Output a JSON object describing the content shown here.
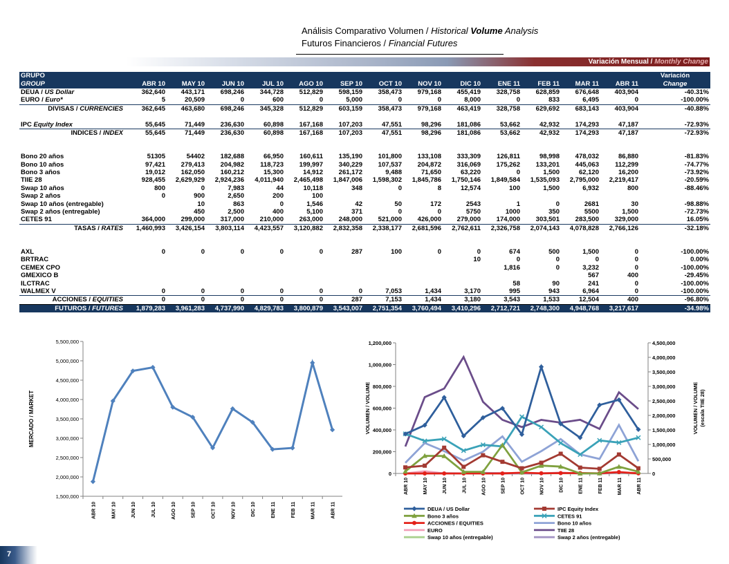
{
  "header": {
    "line1_a": "Análisis Comparativo Volumen / ",
    "line1_b": "Historical ",
    "line1_c": "Volume",
    "line1_d": " Analysis",
    "line2_a": "Futuros Financieros / ",
    "line2_b": "Financial Futures"
  },
  "band": {
    "label_a": "Variación Mensual / ",
    "label_b": "Monthly Change"
  },
  "table": {
    "head1": {
      "grupo": "GRUPO",
      "variacion": "Variación"
    },
    "head2": {
      "group": "GROUP",
      "change": "Change",
      "months": [
        "ABR 10",
        "MAY 10",
        "JUN 10",
        "JUL 10",
        "AGO 10",
        "SEP 10",
        "OCT 10",
        "NOV 10",
        "DIC 10",
        "ENE 11",
        "FEB 11",
        "MAR 11",
        "ABR 11"
      ]
    },
    "deua": {
      "label_a": "DEUA / ",
      "label_b": "US Dollar",
      "v": [
        "362,640",
        "443,171",
        "698,246",
        "344,728",
        "512,829",
        "598,159",
        "358,473",
        "979,168",
        "455,419",
        "328,758",
        "628,859",
        "676,648",
        "403,904"
      ],
      "chg": "-40.31%"
    },
    "euro": {
      "label_a": "EURO / ",
      "label_b": "Euro*",
      "v": [
        "5",
        "20,509",
        "0",
        "600",
        "0",
        "5,000",
        "0",
        "0",
        "8,000",
        "0",
        "833",
        "6,495",
        "0"
      ],
      "chg": "-100.00%"
    },
    "divisas": {
      "label_a": "DIVISAS / ",
      "label_b": "CURRENCIES",
      "v": [
        "362,645",
        "463,680",
        "698,246",
        "345,328",
        "512,829",
        "603,159",
        "358,473",
        "979,168",
        "463,419",
        "328,758",
        "629,692",
        "683,143",
        "403,904"
      ],
      "chg": "-40.88%"
    },
    "ipc": {
      "label_a": "IPC ",
      "label_b": "Equity Index",
      "v": [
        "55,645",
        "71,449",
        "236,630",
        "60,898",
        "167,168",
        "107,203",
        "47,551",
        "98,296",
        "181,086",
        "53,662",
        "42,932",
        "174,293",
        "47,187"
      ],
      "chg": "-72.93%"
    },
    "indices": {
      "label_a": "INDICES / ",
      "label_b": "INDEX",
      "v": [
        "55,645",
        "71,449",
        "236,630",
        "60,898",
        "167,168",
        "107,203",
        "47,551",
        "98,296",
        "181,086",
        "53,662",
        "42,932",
        "174,293",
        "47,187"
      ],
      "chg": "-72.93%"
    },
    "rates": [
      {
        "label": "Bono 20 años",
        "v": [
          "51305",
          "54402",
          "182,688",
          "66,950",
          "160,611",
          "135,190",
          "101,800",
          "133,108",
          "333,309",
          "126,811",
          "98,998",
          "478,032",
          "86,880"
        ],
        "chg": "-81.83%"
      },
      {
        "label": "Bono 10 años",
        "v": [
          "97,421",
          "279,413",
          "204,982",
          "118,723",
          "199,997",
          "340,229",
          "107,537",
          "204,872",
          "316,069",
          "175,262",
          "133,201",
          "445,063",
          "112,299"
        ],
        "chg": "-74.77%"
      },
      {
        "label": "Bono 3 años",
        "v": [
          "19,012",
          "162,050",
          "160,212",
          "15,300",
          "14,912",
          "261,172",
          "9,488",
          "71,650",
          "63,220",
          "0",
          "1,500",
          "62,120",
          "16,200"
        ],
        "chg": "-73.92%"
      },
      {
        "label": "TIIE 28",
        "v": [
          "928,455",
          "2,629,929",
          "2,924,236",
          "4,011,940",
          "2,465,498",
          "1,847,006",
          "1,598,302",
          "1,845,786",
          "1,750,146",
          "1,849,584",
          "1,535,093",
          "2,795,000",
          "2,219,417"
        ],
        "chg": "-20.59%"
      },
      {
        "label": "Swap 10 años",
        "v": [
          "800",
          "0",
          "7,983",
          "44",
          "10,118",
          "348",
          "0",
          "8",
          "12,574",
          "100",
          "1,500",
          "6,932",
          "800"
        ],
        "chg": "-88.46%"
      },
      {
        "label": "Swap 2 años",
        "v": [
          "0",
          "900",
          "2,650",
          "200",
          "100",
          "",
          "",
          "",
          "",
          "",
          "",
          "",
          ""
        ],
        "chg": ""
      },
      {
        "label": "Swap 10 años (entregable)",
        "v": [
          "",
          "10",
          "863",
          "0",
          "1,546",
          "42",
          "50",
          "172",
          "2543",
          "1",
          "0",
          "2681",
          "30"
        ],
        "chg": "-98.88%"
      },
      {
        "label": "Swap 2 años (entregable)",
        "v": [
          "",
          "450",
          "2,500",
          "400",
          "5,100",
          "371",
          "0",
          "0",
          "5750",
          "1000",
          "350",
          "5500",
          "1,500"
        ],
        "chg": "-72.73%"
      },
      {
        "label": "CETES 91",
        "v": [
          "364,000",
          "299,000",
          "317,000",
          "210,000",
          "263,000",
          "248,000",
          "521,000",
          "426,000",
          "279,000",
          "174,000",
          "303,501",
          "283,500",
          "329,000"
        ],
        "chg": "16.05%"
      }
    ],
    "tasas": {
      "label_a": "TASAS / ",
      "label_b": "RATES",
      "v": [
        "1,460,993",
        "3,426,154",
        "3,803,114",
        "4,423,557",
        "3,120,882",
        "2,832,358",
        "2,338,177",
        "2,681,596",
        "2,762,611",
        "2,326,758",
        "2,074,143",
        "4,078,828",
        "2,766,126"
      ],
      "chg": "-32.18%"
    },
    "equities": [
      {
        "label": "AXL",
        "v": [
          "0",
          "0",
          "0",
          "0",
          "0",
          "287",
          "100",
          "0",
          "0",
          "674",
          "500",
          "1,500",
          "0"
        ],
        "chg": "-100.00%"
      },
      {
        "label": "BRTRAC",
        "v": [
          "",
          "",
          "",
          "",
          "",
          "",
          "",
          "",
          "10",
          "0",
          "0",
          "0",
          "0"
        ],
        "chg": "0.00%"
      },
      {
        "label": "CEMEX CPO",
        "v": [
          "",
          "",
          "",
          "",
          "",
          "",
          "",
          "",
          "",
          "1,816",
          "0",
          "3,232",
          "0"
        ],
        "chg": "-100.00%"
      },
      {
        "label": "GMEXICO B",
        "v": [
          "",
          "",
          "",
          "",
          "",
          "",
          "",
          "",
          "",
          "",
          "",
          "567",
          "400"
        ],
        "chg": "-29.45%"
      },
      {
        "label": "ILCTRAC",
        "v": [
          "",
          "",
          "",
          "",
          "",
          "",
          "",
          "",
          "",
          "58",
          "90",
          "241",
          "0"
        ],
        "chg": "-100.00%"
      },
      {
        "label": "WALMEX V",
        "v": [
          "0",
          "0",
          "0",
          "0",
          "0",
          "0",
          "7,053",
          "1,434",
          "3,170",
          "995",
          "943",
          "6,964",
          "0"
        ],
        "chg": "-100.00%"
      }
    ],
    "acciones": {
      "label_a": "ACCIONES / ",
      "label_b": "EQUITIES",
      "v": [
        "0",
        "0",
        "0",
        "0",
        "0",
        "287",
        "7,153",
        "1,434",
        "3,180",
        "3,543",
        "1,533",
        "12,504",
        "400"
      ],
      "chg": "-96.80%"
    },
    "futuros": {
      "label_a": "FUTUROS / ",
      "label_b": "FUTURES",
      "v": [
        "1,879,283",
        "3,961,283",
        "4,737,990",
        "4,829,783",
        "3,800,879",
        "3,543,007",
        "2,751,354",
        "3,760,494",
        "3,410,296",
        "2,712,721",
        "2,748,300",
        "4,948,768",
        "3,217,617"
      ],
      "chg": "-34.98%"
    }
  },
  "chart_data": [
    {
      "type": "line",
      "ylabel": "MERCADO / MARKET",
      "categories": [
        "ABR 10",
        "MAY 10",
        "JUN 10",
        "JUL 10",
        "AGO 10",
        "SEP 10",
        "OCT 10",
        "NOV 10",
        "DIC 10",
        "ENE 11",
        "FEB 11",
        "MAR 11",
        "ABR 11"
      ],
      "series": [
        {
          "values": [
            1879283,
            3961283,
            4737990,
            4829783,
            3800879,
            3543007,
            2751354,
            3760494,
            3410296,
            2712721,
            2748300,
            4948768,
            3217617
          ],
          "color": "#4f81bd"
        }
      ],
      "ylim": [
        1500000,
        5500000
      ],
      "yticks": [
        "1,500,000",
        "2,000,000",
        "2,500,000",
        "3,000,000",
        "3,500,000",
        "4,000,000",
        "4,500,000",
        "5,000,000",
        "5,500,000"
      ],
      "grid": false
    },
    {
      "type": "line",
      "ylabel": "VOLUMEN / VOLUME",
      "ylabel_right_a": "VOLUMEN / VOLUME",
      "ylabel_right_b": "(escala TIIE 28)",
      "categories": [
        "ABR 10",
        "MAY 10",
        "JUN 10",
        "JUL 10",
        "AGO 10",
        "SEP 10",
        "OCT 10",
        "NOV 10",
        "DIC 10",
        "ENE 11",
        "FEB 11",
        "MAR 11",
        "ABR 11"
      ],
      "ylim": [
        0,
        1200000
      ],
      "yticks": [
        "0",
        "200,000",
        "400,000",
        "600,000",
        "800,000",
        "1,000,000",
        "1,200,000"
      ],
      "ylim_right": [
        0,
        4500000
      ],
      "yticks_right": [
        "0",
        "500,000",
        "1,000,000",
        "1,500,000",
        "2,000,000",
        "2,500,000",
        "3,000,000",
        "3,500,000",
        "4,000,000",
        "4,500,000"
      ],
      "legend": "bottom",
      "series": [
        {
          "name": "DEUA / US Dollar",
          "color": "#2f5f9c",
          "marker": "diamond",
          "axis": "left",
          "values": [
            362640,
            443171,
            698246,
            344728,
            512829,
            598159,
            358473,
            979168,
            455419,
            328758,
            628859,
            676648,
            403904
          ]
        },
        {
          "name": "IPC  Equity Index",
          "color": "#a33a32",
          "marker": "square",
          "axis": "left",
          "values": [
            55645,
            71449,
            236630,
            60898,
            167168,
            107203,
            47551,
            98296,
            181086,
            53662,
            42932,
            174293,
            47187
          ]
        },
        {
          "name": "Bono 3 años",
          "color": "#7fa13f",
          "marker": "triangle",
          "axis": "left",
          "values": [
            19012,
            162050,
            160212,
            15300,
            14912,
            261172,
            9488,
            71650,
            63220,
            0,
            1500,
            62120,
            16200
          ]
        },
        {
          "name": "CETES 91",
          "color": "#3aa2b8",
          "marker": "x",
          "axis": "left",
          "values": [
            364000,
            299000,
            317000,
            210000,
            263000,
            248000,
            521000,
            426000,
            279000,
            174000,
            303501,
            283500,
            329000
          ]
        },
        {
          "name": "ACCIONES / EQUITIES",
          "color": "#e32119",
          "marker": "circle",
          "axis": "left",
          "values": [
            0,
            0,
            0,
            0,
            0,
            287,
            7153,
            1434,
            3180,
            3543,
            1533,
            12504,
            400
          ]
        },
        {
          "name": "Bono 10 años",
          "color": "#8ea3d6",
          "marker": "none",
          "axis": "left",
          "values": [
            97421,
            279413,
            204982,
            118723,
            199997,
            340229,
            107537,
            204872,
            316069,
            175262,
            133201,
            445063,
            112299
          ]
        },
        {
          "name": "EURO",
          "color": "#f2a0b8",
          "marker": "none",
          "axis": "left",
          "values": [
            5,
            20509,
            0,
            600,
            0,
            5000,
            0,
            0,
            8000,
            0,
            833,
            6495,
            0
          ]
        },
        {
          "name": "TIIE 28",
          "color": "#6b4d8a",
          "marker": "none",
          "axis": "right",
          "values": [
            928455,
            2629929,
            2924236,
            4011940,
            2465498,
            1847006,
            1598302,
            1845786,
            1750146,
            1849584,
            1535093,
            2795000,
            2219417
          ]
        },
        {
          "name": "Swap 10 años (entregable)",
          "color": "#a9d18e",
          "marker": "none",
          "axis": "left",
          "values": [
            0,
            10,
            863,
            0,
            1546,
            42,
            50,
            172,
            2543,
            1,
            0,
            2681,
            30
          ]
        },
        {
          "name": "Swap 2 años (entregable)",
          "color": "#a494c4",
          "marker": "none",
          "axis": "left",
          "values": [
            0,
            450,
            2500,
            400,
            5100,
            371,
            0,
            0,
            5750,
            1000,
            350,
            5500,
            1500
          ]
        }
      ]
    }
  ],
  "page": {
    "number": "7"
  }
}
